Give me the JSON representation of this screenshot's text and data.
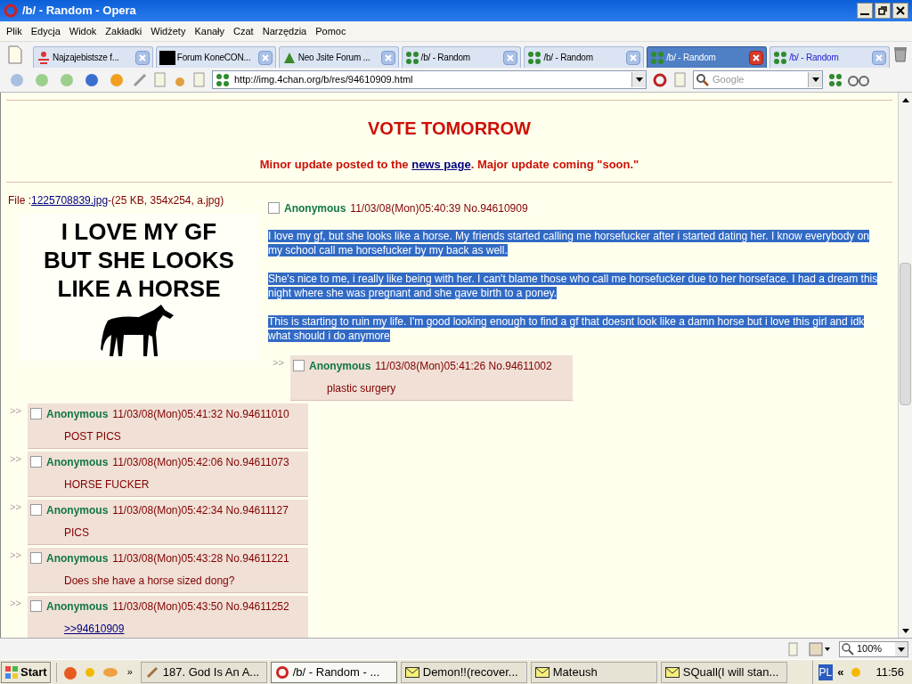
{
  "window": {
    "title": "/b/ - Random - Opera"
  },
  "menu": [
    "Plik",
    "Edycja",
    "Widok",
    "Zakładki",
    "Widżety",
    "Kanały",
    "Czat",
    "Narzędzia",
    "Pomoc"
  ],
  "tabs": [
    {
      "label": "Najzajebistsze f...",
      "selected": false,
      "kind": "person",
      "unread": false
    },
    {
      "label": "Forum KoneCON...",
      "selected": false,
      "kind": "dark",
      "unread": false
    },
    {
      "label": "Neo Jsite Forum ...",
      "selected": false,
      "kind": "leaf",
      "unread": false
    },
    {
      "label": "/b/ - Random",
      "selected": false,
      "kind": "clover",
      "unread": false
    },
    {
      "label": "/b/ - Random",
      "selected": false,
      "kind": "clover",
      "unread": false
    },
    {
      "label": "/b/ - Random",
      "selected": true,
      "kind": "clover",
      "unread": false
    },
    {
      "label": "/b/ - Random",
      "selected": false,
      "kind": "clover",
      "unread": true
    }
  ],
  "address": {
    "url": "http://img.4chan.org/b/res/94610909.html"
  },
  "search": {
    "placeholder": "Google"
  },
  "page": {
    "banner": "VOTE TOMORROW",
    "notice": {
      "before": "Minor update posted to the ",
      "link": "news page",
      "after": ". Major update coming \"soon.\""
    },
    "file": {
      "label": "File :",
      "filename": "1225708839.jpg",
      "info": "-(25 KB, 354x254, a.jpg)"
    },
    "image_text": [
      "I LOVE MY GF",
      "BUT SHE LOOKS",
      "LIKE A HORSE"
    ],
    "op": {
      "name": "Anonymous",
      "date": "11/03/08(Mon)05:40:39 No.94610909",
      "checked": false,
      "text_selected": true,
      "paragraphs": [
        "I love my gf, but she looks like a horse. My friends started calling me horsefucker after i started dating her. I know everybody on my school call me horsefucker by my back as well.",
        "She's nice to me, i really like being with her. I can't blame those who call me horsefucker due to her horseface. I had a dream this night where she was pregnant and she gave birth to a poney.",
        "This is starting to ruin my life. I'm good looking enough to find a gf that doesnt look like a damn horse but i love this girl and idk what should i do anymore"
      ]
    },
    "replies": [
      {
        "marker": ">>",
        "name": "Anonymous",
        "date": "11/03/08(Mon)05:41:26 No.94611002",
        "body": "plastic surgery",
        "kind": "text",
        "checked": false,
        "indented": true
      },
      {
        "marker": ">>",
        "name": "Anonymous",
        "date": "11/03/08(Mon)05:41:32 No.94611010",
        "body": "POST PICS",
        "kind": "text",
        "checked": false,
        "indented": false
      },
      {
        "marker": ">>",
        "name": "Anonymous",
        "date": "11/03/08(Mon)05:42:06 No.94611073",
        "body": "HORSE FUCKER",
        "kind": "text",
        "checked": false,
        "indented": false
      },
      {
        "marker": ">>",
        "name": "Anonymous",
        "date": "11/03/08(Mon)05:42:34 No.94611127",
        "body": "PICS",
        "kind": "text",
        "checked": false,
        "indented": false
      },
      {
        "marker": ">>",
        "name": "Anonymous",
        "date": "11/03/08(Mon)05:43:28 No.94611221",
        "body": "Does she have a horse sized dong?",
        "kind": "text",
        "checked": false,
        "indented": false
      },
      {
        "marker": ">>",
        "name": "Anonymous",
        "date": "11/03/08(Mon)05:43:50 No.94611252",
        "body": ">>94610909",
        "kind": "link",
        "checked": false,
        "indented": false
      }
    ]
  },
  "status_bar": {
    "zoom": "100%"
  },
  "taskbar": {
    "start": "Start",
    "more": "»",
    "items": [
      {
        "label": "187. God Is An A...",
        "selected": false,
        "kind": "app"
      },
      {
        "label": "/b/ - Random - ...",
        "selected": true,
        "kind": "opera"
      },
      {
        "label": "Demon!!(recover...",
        "selected": false,
        "kind": "mail"
      },
      {
        "label": "Mateush",
        "selected": false,
        "kind": "mail"
      },
      {
        "label": "SQuall(I will stan...",
        "selected": false,
        "kind": "mail"
      }
    ],
    "language": "PL",
    "expand": "«",
    "clock": "11:56"
  }
}
